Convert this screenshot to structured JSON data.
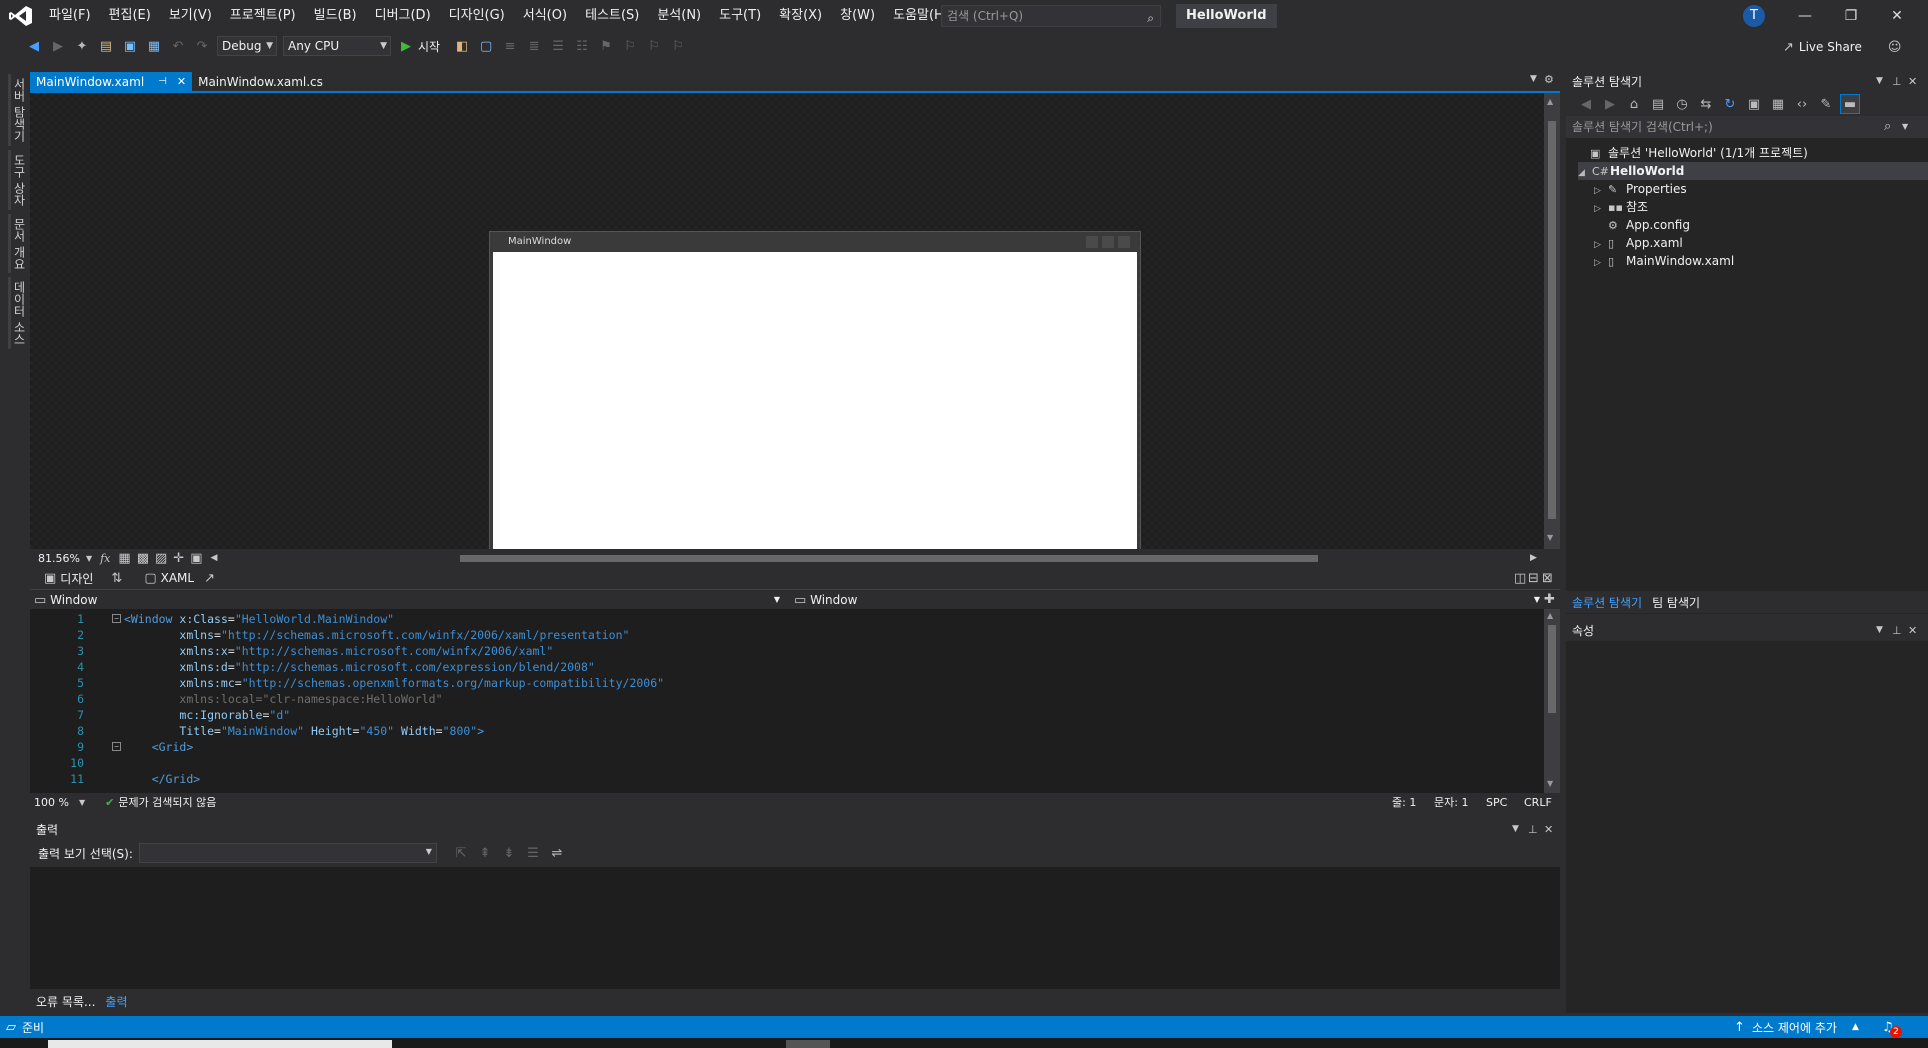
{
  "menu": [
    "파일(F)",
    "편집(E)",
    "보기(V)",
    "프로젝트(P)",
    "빌드(B)",
    "디버그(D)",
    "디자인(G)",
    "서식(O)",
    "테스트(S)",
    "분석(N)",
    "도구(T)",
    "확장(X)",
    "창(W)",
    "도움말(H)"
  ],
  "search": {
    "placeholder": "검색 (Ctrl+Q)"
  },
  "solution_title": "HelloWorld",
  "avatar_initial": "T",
  "toolbar": {
    "config": "Debug",
    "platform": "Any CPU",
    "start_label": "시작",
    "live_share": "Live Share"
  },
  "left_strip": [
    "서버 탐색기",
    "도구 상자",
    "문서 개요",
    "데이터 소스"
  ],
  "doc_tabs": [
    {
      "label": "MainWindow.xaml",
      "active": true
    },
    {
      "label": "MainWindow.xaml.cs",
      "active": false
    }
  ],
  "designer": {
    "window_title": "MainWindow",
    "zoom": "81.56%"
  },
  "split_tabs": {
    "design": "디자인",
    "xaml": "XAML"
  },
  "nav": {
    "left": "Window",
    "right": "Window"
  },
  "code_lines": [
    {
      "n": "1",
      "html": "<span class='t-tag'>&lt;Window</span> <span class='t-attr'>x:Class</span>=<span class='t-str'>\"HelloWorld.MainWindow\"</span>"
    },
    {
      "n": "2",
      "html": "        <span class='t-attr'>xmlns</span>=<span class='t-str'>\"http://schemas.microsoft.com/winfx/2006/xaml/presentation\"</span>"
    },
    {
      "n": "3",
      "html": "        <span class='t-attr'>xmlns:x</span>=<span class='t-str'>\"http://schemas.microsoft.com/winfx/2006/xaml\"</span>"
    },
    {
      "n": "4",
      "html": "        <span class='t-attr'>xmlns:d</span>=<span class='t-str'>\"http://schemas.microsoft.com/expression/blend/2008\"</span>"
    },
    {
      "n": "5",
      "html": "        <span class='t-attr'>xmlns:mc</span>=<span class='t-str'>\"http://schemas.openxmlformats.org/markup-compatibility/2006\"</span>"
    },
    {
      "n": "6",
      "html": "        <span class='t-dim'>xmlns:local=\"clr-namespace:HelloWorld\"</span>"
    },
    {
      "n": "7",
      "html": "        <span class='t-attr'>mc:Ignorable</span>=<span class='t-str'>\"d\"</span>"
    },
    {
      "n": "8",
      "html": "        <span class='t-attr'>Title</span>=<span class='t-str'>\"MainWindow\"</span> <span class='t-attr'>Height</span>=<span class='t-str'>\"450\"</span> <span class='t-attr'>Width</span>=<span class='t-str'>\"800\"</span><span class='t-tag'>&gt;</span>"
    },
    {
      "n": "9",
      "html": "    <span class='t-tag'>&lt;Grid&gt;</span>"
    },
    {
      "n": "10",
      "html": ""
    },
    {
      "n": "11",
      "html": "    <span class='t-tag'>&lt;/Grid&gt;</span>"
    }
  ],
  "editor_status": {
    "zoom": "100 %",
    "issues": "문제가 검색되지 않음",
    "line": "줄: 1",
    "col": "문자: 1",
    "spc": "SPC",
    "eol": "CRLF"
  },
  "output": {
    "title": "출력",
    "show_label": "출력 보기 선택(S):"
  },
  "bottom_tabs": [
    "오류 목록...",
    "출력"
  ],
  "solution_explorer": {
    "title": "솔루션 탐색기",
    "search_placeholder": "솔루션 탐색기 검색(Ctrl+;)",
    "solution_node": "솔루션 'HelloWorld' (1/1개 프로젝트)",
    "project": "HelloWorld",
    "items": [
      "Properties",
      "참조",
      "App.config",
      "App.xaml",
      "MainWindow.xaml"
    ]
  },
  "side_tabs": [
    "솔루션 탐색기",
    "팀 탐색기"
  ],
  "properties": {
    "title": "속성"
  },
  "status": {
    "ready": "준비",
    "source_control": "소스 제어에 추가",
    "notify_count": "2"
  },
  "colors": {
    "accent": "#007acc",
    "background": "#2d2d30",
    "editor": "#1e1e1e"
  }
}
